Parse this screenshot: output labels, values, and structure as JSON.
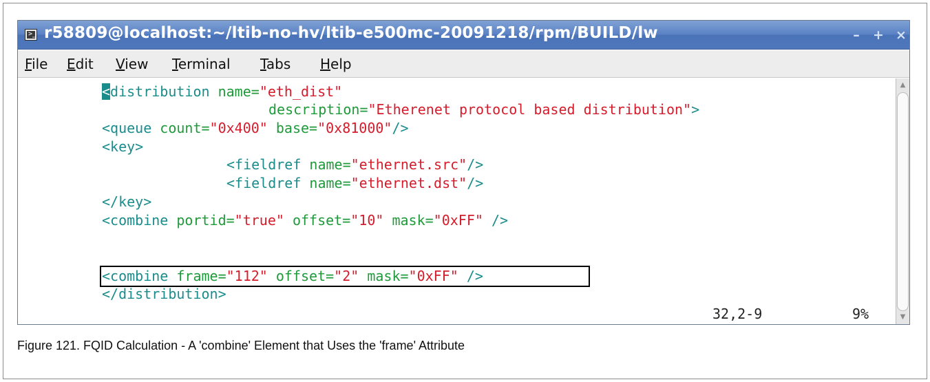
{
  "window": {
    "title": "r58809@localhost:~/ltib-no-hv/ltib-e500mc-20091218/rpm/BUILD/lw",
    "icon": "terminal-icon",
    "controls": {
      "minimize": "minimize-icon",
      "maximize": "maximize-icon",
      "close": "close-icon"
    }
  },
  "menu": [
    {
      "mnemonic": "F",
      "rest": "ile"
    },
    {
      "mnemonic": "E",
      "rest": "dit"
    },
    {
      "mnemonic": "V",
      "rest": "iew"
    },
    {
      "mnemonic": "T",
      "rest": "erminal"
    },
    {
      "mnemonic": "T",
      "rest": "abs"
    },
    {
      "mnemonic": "H",
      "rest": "elp"
    }
  ],
  "code": {
    "l1": {
      "cursor": "<",
      "tag": "distribution ",
      "attr": "name=",
      "val": "\"eth_dist\""
    },
    "l2": {
      "attr": "description=",
      "val": "\"Etherenet protocol based distribution\"",
      "tag": ">"
    },
    "l3": {
      "tag1": "<queue ",
      "attr1": "count=",
      "val1": "\"0x400\"",
      "attr2": " base=",
      "val2": "\"0x81000\"",
      "tag2": "/>"
    },
    "l4": {
      "tag": "<key>"
    },
    "l5": {
      "tag1": "<fieldref ",
      "attr": "name=",
      "val": "\"ethernet.src\"",
      "tag2": "/>"
    },
    "l6": {
      "tag1": "<fieldref ",
      "attr": "name=",
      "val": "\"ethernet.dst\"",
      "tag2": "/>"
    },
    "l7": {
      "tag": "</key>"
    },
    "l8": {
      "tag1": "<combine ",
      "attr1": "portid=",
      "val1": "\"true\"",
      "attr2": " offset=",
      "val2": "\"10\"",
      "attr3": " mask=",
      "val3": "\"0xFF\"",
      "tag2": " />"
    },
    "l9": {
      "tag1": "<combine ",
      "attr1": "frame=",
      "val1": "\"112\"",
      "attr2": " offset=",
      "val2": "\"2\"",
      "attr3": " mask=",
      "val3": "\"0xFF\"",
      "tag2": " />"
    },
    "l10": {
      "tag": "</distribution>"
    }
  },
  "status": {
    "position": "32,2-9",
    "percent": "9%"
  },
  "caption": "Figure 121. FQID Calculation - A 'combine' Element that Uses the 'frame' Attribute",
  "colors": {
    "titlebar": "#5b82c4",
    "tag": "#1a8c8c",
    "attribute": "#1e9a3a",
    "value": "#d41c2c",
    "highlight_border": "#000000"
  }
}
